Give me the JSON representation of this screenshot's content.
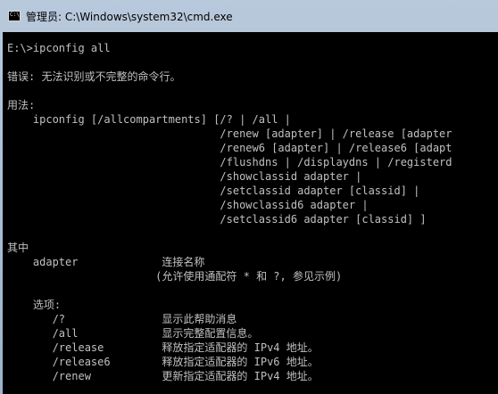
{
  "window": {
    "title": "管理员: C:\\Windows\\system32\\cmd.exe",
    "icon_label": "C:\\",
    "icon": "cmd-icon"
  },
  "console": {
    "lines": [
      "E:\\>ipconfig all",
      "",
      "错误: 无法识别或不完整的命令行。",
      "",
      "用法:",
      "    ipconfig [/allcompartments] [/? | /all |",
      "                                 /renew [adapter] | /release [adapter",
      "                                 /renew6 [adapter] | /release6 [adapt",
      "                                 /flushdns | /displaydns | /registerd",
      "                                 /showclassid adapter |",
      "                                 /setclassid adapter [classid] |",
      "                                 /showclassid6 adapter |",
      "                                 /setclassid6 adapter [classid] ]",
      "",
      "其中",
      "    adapter             连接名称",
      "                       (允许使用通配符 * 和 ?, 参见示例)",
      "",
      "    选项:",
      "       /?               显示此帮助消息",
      "       /all             显示完整配置信息。",
      "       /release         释放指定适配器的 IPv4 地址。",
      "       /release6        释放指定适配器的 IPv6 地址。",
      "       /renew           更新指定适配器的 IPv4 地址。"
    ]
  },
  "colors": {
    "console_bg": "#000000",
    "console_text": "#c0c0c0",
    "titlebar": "#b9c9dc"
  }
}
